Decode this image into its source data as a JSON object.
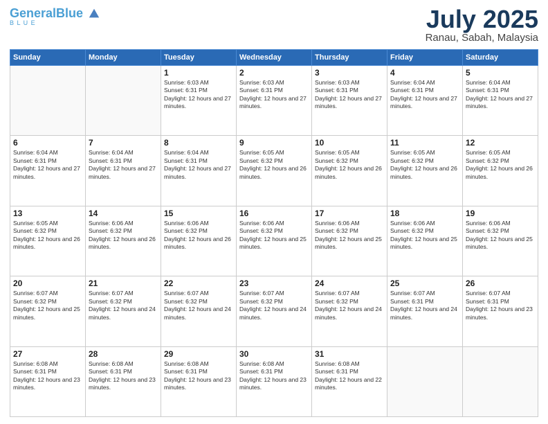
{
  "header": {
    "logo_line1": "General",
    "logo_accent": "Blue",
    "title": "July 2025",
    "subtitle": "Ranau, Sabah, Malaysia"
  },
  "weekdays": [
    "Sunday",
    "Monday",
    "Tuesday",
    "Wednesday",
    "Thursday",
    "Friday",
    "Saturday"
  ],
  "weeks": [
    {
      "days": [
        {
          "num": "",
          "info": ""
        },
        {
          "num": "",
          "info": ""
        },
        {
          "num": "1",
          "info": "Sunrise: 6:03 AM\nSunset: 6:31 PM\nDaylight: 12 hours and 27 minutes."
        },
        {
          "num": "2",
          "info": "Sunrise: 6:03 AM\nSunset: 6:31 PM\nDaylight: 12 hours and 27 minutes."
        },
        {
          "num": "3",
          "info": "Sunrise: 6:03 AM\nSunset: 6:31 PM\nDaylight: 12 hours and 27 minutes."
        },
        {
          "num": "4",
          "info": "Sunrise: 6:04 AM\nSunset: 6:31 PM\nDaylight: 12 hours and 27 minutes."
        },
        {
          "num": "5",
          "info": "Sunrise: 6:04 AM\nSunset: 6:31 PM\nDaylight: 12 hours and 27 minutes."
        }
      ]
    },
    {
      "days": [
        {
          "num": "6",
          "info": "Sunrise: 6:04 AM\nSunset: 6:31 PM\nDaylight: 12 hours and 27 minutes."
        },
        {
          "num": "7",
          "info": "Sunrise: 6:04 AM\nSunset: 6:31 PM\nDaylight: 12 hours and 27 minutes."
        },
        {
          "num": "8",
          "info": "Sunrise: 6:04 AM\nSunset: 6:31 PM\nDaylight: 12 hours and 27 minutes."
        },
        {
          "num": "9",
          "info": "Sunrise: 6:05 AM\nSunset: 6:32 PM\nDaylight: 12 hours and 26 minutes."
        },
        {
          "num": "10",
          "info": "Sunrise: 6:05 AM\nSunset: 6:32 PM\nDaylight: 12 hours and 26 minutes."
        },
        {
          "num": "11",
          "info": "Sunrise: 6:05 AM\nSunset: 6:32 PM\nDaylight: 12 hours and 26 minutes."
        },
        {
          "num": "12",
          "info": "Sunrise: 6:05 AM\nSunset: 6:32 PM\nDaylight: 12 hours and 26 minutes."
        }
      ]
    },
    {
      "days": [
        {
          "num": "13",
          "info": "Sunrise: 6:05 AM\nSunset: 6:32 PM\nDaylight: 12 hours and 26 minutes."
        },
        {
          "num": "14",
          "info": "Sunrise: 6:06 AM\nSunset: 6:32 PM\nDaylight: 12 hours and 26 minutes."
        },
        {
          "num": "15",
          "info": "Sunrise: 6:06 AM\nSunset: 6:32 PM\nDaylight: 12 hours and 26 minutes."
        },
        {
          "num": "16",
          "info": "Sunrise: 6:06 AM\nSunset: 6:32 PM\nDaylight: 12 hours and 25 minutes."
        },
        {
          "num": "17",
          "info": "Sunrise: 6:06 AM\nSunset: 6:32 PM\nDaylight: 12 hours and 25 minutes."
        },
        {
          "num": "18",
          "info": "Sunrise: 6:06 AM\nSunset: 6:32 PM\nDaylight: 12 hours and 25 minutes."
        },
        {
          "num": "19",
          "info": "Sunrise: 6:06 AM\nSunset: 6:32 PM\nDaylight: 12 hours and 25 minutes."
        }
      ]
    },
    {
      "days": [
        {
          "num": "20",
          "info": "Sunrise: 6:07 AM\nSunset: 6:32 PM\nDaylight: 12 hours and 25 minutes."
        },
        {
          "num": "21",
          "info": "Sunrise: 6:07 AM\nSunset: 6:32 PM\nDaylight: 12 hours and 24 minutes."
        },
        {
          "num": "22",
          "info": "Sunrise: 6:07 AM\nSunset: 6:32 PM\nDaylight: 12 hours and 24 minutes."
        },
        {
          "num": "23",
          "info": "Sunrise: 6:07 AM\nSunset: 6:32 PM\nDaylight: 12 hours and 24 minutes."
        },
        {
          "num": "24",
          "info": "Sunrise: 6:07 AM\nSunset: 6:32 PM\nDaylight: 12 hours and 24 minutes."
        },
        {
          "num": "25",
          "info": "Sunrise: 6:07 AM\nSunset: 6:31 PM\nDaylight: 12 hours and 24 minutes."
        },
        {
          "num": "26",
          "info": "Sunrise: 6:07 AM\nSunset: 6:31 PM\nDaylight: 12 hours and 23 minutes."
        }
      ]
    },
    {
      "days": [
        {
          "num": "27",
          "info": "Sunrise: 6:08 AM\nSunset: 6:31 PM\nDaylight: 12 hours and 23 minutes."
        },
        {
          "num": "28",
          "info": "Sunrise: 6:08 AM\nSunset: 6:31 PM\nDaylight: 12 hours and 23 minutes."
        },
        {
          "num": "29",
          "info": "Sunrise: 6:08 AM\nSunset: 6:31 PM\nDaylight: 12 hours and 23 minutes."
        },
        {
          "num": "30",
          "info": "Sunrise: 6:08 AM\nSunset: 6:31 PM\nDaylight: 12 hours and 23 minutes."
        },
        {
          "num": "31",
          "info": "Sunrise: 6:08 AM\nSunset: 6:31 PM\nDaylight: 12 hours and 22 minutes."
        },
        {
          "num": "",
          "info": ""
        },
        {
          "num": "",
          "info": ""
        }
      ]
    }
  ]
}
